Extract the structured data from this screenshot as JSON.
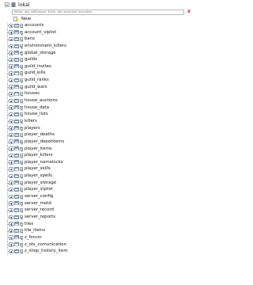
{
  "database": {
    "name": "lokal"
  },
  "filter": {
    "placeholder": "Wpisz, aby odfiltrować. Enter, aby wyszukać wszystkie",
    "clear_symbol": "x"
  },
  "new_item": {
    "label": "New"
  },
  "tables": [
    {
      "name": "accounts"
    },
    {
      "name": "account_viplist"
    },
    {
      "name": "bans"
    },
    {
      "name": "environment_killers"
    },
    {
      "name": "global_storage"
    },
    {
      "name": "guilds"
    },
    {
      "name": "guild_invites"
    },
    {
      "name": "guild_kills"
    },
    {
      "name": "guild_ranks"
    },
    {
      "name": "guild_wars"
    },
    {
      "name": "houses"
    },
    {
      "name": "house_auctions"
    },
    {
      "name": "house_data"
    },
    {
      "name": "house_lists"
    },
    {
      "name": "killers"
    },
    {
      "name": "players"
    },
    {
      "name": "player_deaths"
    },
    {
      "name": "player_depotitems"
    },
    {
      "name": "player_items"
    },
    {
      "name": "player_killers"
    },
    {
      "name": "player_namelocks"
    },
    {
      "name": "player_skills"
    },
    {
      "name": "player_spells"
    },
    {
      "name": "player_storage"
    },
    {
      "name": "player_viplist"
    },
    {
      "name": "server_config"
    },
    {
      "name": "server_motd"
    },
    {
      "name": "server_record"
    },
    {
      "name": "server_reports"
    },
    {
      "name": "tiles"
    },
    {
      "name": "tile_items"
    },
    {
      "name": "z_forum"
    },
    {
      "name": "z_ots_comunication"
    },
    {
      "name": "z_shop_history_item"
    }
  ]
}
